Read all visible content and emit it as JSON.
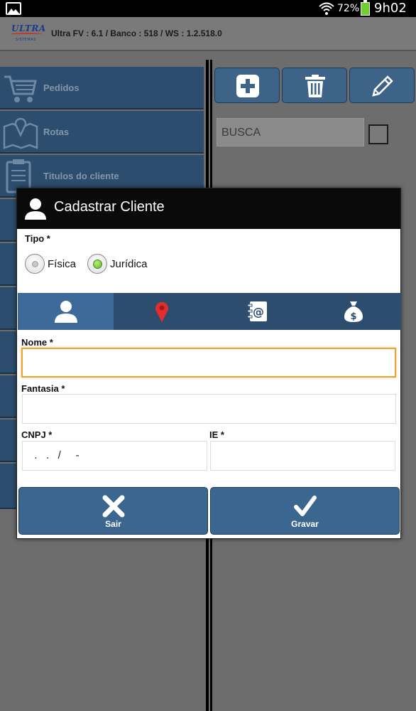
{
  "status_bar": {
    "battery": "72%",
    "time": "9h02"
  },
  "app": {
    "logo_text": "ULTRA",
    "logo_subtext": "SISTEMAS",
    "title": "Ultra FV : 6.1 / Banco : 518 / WS : 1.2.518.0"
  },
  "sidebar": {
    "items": [
      {
        "label": "Pedidos",
        "icon": "cart-icon"
      },
      {
        "label": "Rotas",
        "icon": "map-icon"
      },
      {
        "label": "Titulos do cliente",
        "icon": "document-icon"
      }
    ]
  },
  "toolbar": {
    "add_icon": "plus-icon",
    "delete_icon": "trash-icon",
    "edit_icon": "pencil-icon"
  },
  "search": {
    "placeholder": "BUSCA"
  },
  "dialog": {
    "title": "Cadastrar Cliente",
    "tipo_label": "Tipo *",
    "tipo_options": [
      {
        "label": "Física",
        "selected": false
      },
      {
        "label": "Jurídica",
        "selected": true
      }
    ],
    "tabs": [
      {
        "icon": "user-icon",
        "active": true
      },
      {
        "icon": "map-pin-icon",
        "active": false
      },
      {
        "icon": "address-book-icon",
        "active": false
      },
      {
        "icon": "money-bag-icon",
        "active": false
      }
    ],
    "fields": {
      "nome_label": "Nome *",
      "nome_value": "",
      "fantasia_label": "Fantasia *",
      "fantasia_value": "",
      "cnpj_label": "CNPJ *",
      "cnpj_value": "  .   .   /     -",
      "ie_label": "IE *",
      "ie_value": ""
    },
    "buttons": {
      "sair": "Sair",
      "gravar": "Gravar"
    }
  },
  "colors": {
    "accent_blue": "#3b6690",
    "dark_navy": "#2d4d6e",
    "focus_orange": "#e8a330",
    "radio_green": "#5fb62a"
  }
}
